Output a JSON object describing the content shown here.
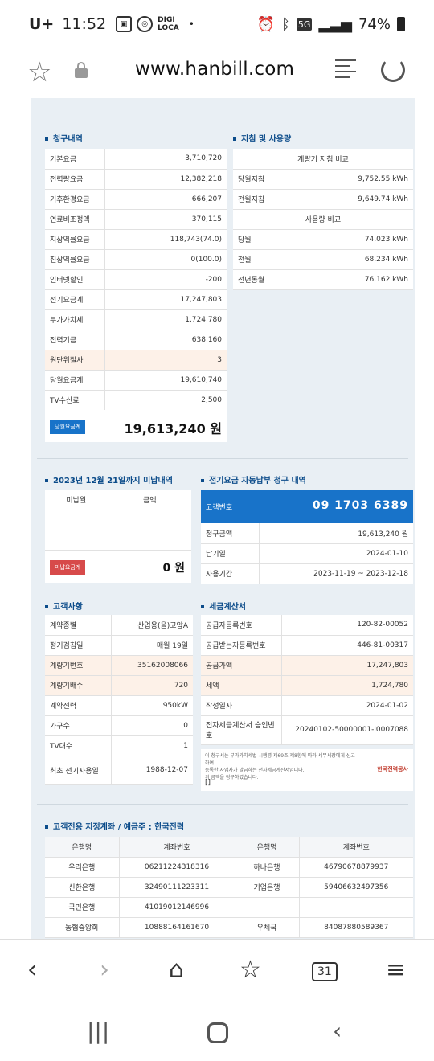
{
  "status": {
    "carrier": "U+",
    "time": "11:52",
    "digi": "DIGI",
    "loca": "LOCA",
    "dot": "•",
    "network": "5G",
    "battery": "74%"
  },
  "browser": {
    "url": "www.hanbill.com"
  },
  "billing": {
    "title": "청구내역",
    "rows": [
      {
        "label": "기본요금",
        "value": "3,710,720"
      },
      {
        "label": "전력량요금",
        "value": "12,382,218"
      },
      {
        "label": "기후환경요금",
        "value": "666,207"
      },
      {
        "label": "연료비조정액",
        "value": "370,115"
      },
      {
        "label": "지상역률요금",
        "value": "118,743(74.0)"
      },
      {
        "label": "진상역률요금",
        "value": "0(100.0)"
      },
      {
        "label": "인터넷할인",
        "value": "-200"
      },
      {
        "label": "전기요금계",
        "value": "17,247,803"
      },
      {
        "label": "부가가치세",
        "value": "1,724,780"
      },
      {
        "label": "전력기금",
        "value": "638,160"
      },
      {
        "label": "원단위절사",
        "value": "3"
      },
      {
        "label": "당월요금계",
        "value": "19,610,740"
      },
      {
        "label": "TV수신료",
        "value": "2,500"
      }
    ],
    "total_tag": "당월요금계",
    "total": "19,613,240 원"
  },
  "meter": {
    "title": "지침 및 사용량",
    "compare_header": "계량기 지침 비교",
    "rows1": [
      {
        "label": "당월지침",
        "value": "9,752.55 kWh"
      },
      {
        "label": "전월지침",
        "value": "9,649.74 kWh"
      }
    ],
    "usage_header": "사용량 비교",
    "rows2": [
      {
        "label": "당월",
        "value": "74,023 kWh"
      },
      {
        "label": "전월",
        "value": "68,234 kWh"
      },
      {
        "label": "전년동월",
        "value": "76,162 kWh"
      }
    ]
  },
  "unpaid": {
    "title": "2023년 12월 21일까지 미납내역",
    "col1": "미납월",
    "col2": "금액",
    "tag": "미납요금계",
    "total": "0 원"
  },
  "autopay": {
    "title": "전기요금 자동납부 청구 내역",
    "cust_label": "고객번호",
    "cust_no": "09  1703  6389",
    "rows": [
      {
        "label": "청구금액",
        "value": "19,613,240 원"
      },
      {
        "label": "납기일",
        "value": "2024-01-10"
      },
      {
        "label": "사용기간",
        "value": "2023-11-19 ~ 2023-12-18"
      }
    ]
  },
  "customer": {
    "title": "고객사항",
    "rows": [
      {
        "label": "계약종별",
        "value": "산업용(을)고압A"
      },
      {
        "label": "정기검침일",
        "value": "매월 19일"
      },
      {
        "label": "계량기번호",
        "value": "35162008066"
      },
      {
        "label": "계량기배수",
        "value": "720"
      },
      {
        "label": "계약전력",
        "value": "950kW"
      },
      {
        "label": "가구수",
        "value": "0"
      },
      {
        "label": "TV대수",
        "value": "1"
      },
      {
        "label": "최초 전기사용일",
        "value": "1988-12-07"
      }
    ]
  },
  "tax": {
    "title": "세금계산서",
    "rows": [
      {
        "label": "공급자등록번호",
        "value": "120-82-00052"
      },
      {
        "label": "공급받는자등록번호",
        "value": "446-81-00317"
      },
      {
        "label": "공급가액",
        "value": "17,247,803"
      },
      {
        "label": "세액",
        "value": "1,724,780"
      },
      {
        "label": "작성일자",
        "value": "2024-01-02"
      },
      {
        "label": "전자세금계산서 승인번호",
        "value": "20240102-50000001-i0007088"
      }
    ],
    "note1": "이 청구서는 부가가치세법 시행령 제69조 제8항에 따라 세무서장에게 신고하여",
    "note2": "등록한 사업자가 발급하는 전자세금계산서입니다.",
    "note3": "위 금액을 청구하였습니다.",
    "company": "한국전력공사",
    "bracket": "[]"
  },
  "accounts": {
    "title": "고객전용 지정계좌 / 예금주 : 한국전력",
    "headers": [
      "은행명",
      "계좌번호",
      "은행명",
      "계좌번호"
    ],
    "rows": [
      [
        "우리은행",
        "06211224318316",
        "하나은행",
        "46790678879937"
      ],
      [
        "신한은행",
        "32490111223311",
        "기업은행",
        "59406632497356"
      ],
      [
        "국민은행",
        "41019012146996",
        "",
        ""
      ],
      [
        "농협중앙회",
        "10888164161670",
        "우체국",
        "84087880589367"
      ]
    ]
  }
}
